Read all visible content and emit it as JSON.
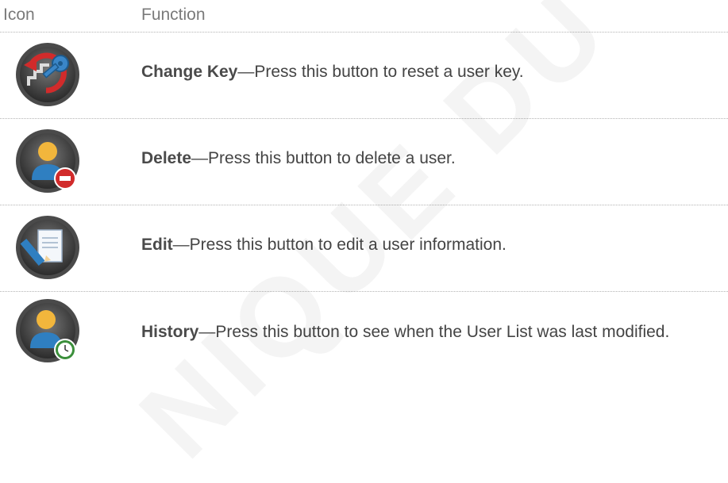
{
  "header": {
    "icon_col": "Icon",
    "function_col": "Function"
  },
  "rows": [
    {
      "icon": "change-key-icon",
      "term": "Change Key",
      "dash": "—",
      "text": "Press this button to reset a user key."
    },
    {
      "icon": "delete-user-icon",
      "term": "Delete",
      "dash": "—",
      "text": "Press this button to delete a user."
    },
    {
      "icon": "edit-user-icon",
      "term": "Edit",
      "dash": "—",
      "text": "Press this button to edit a user information."
    },
    {
      "icon": "history-icon",
      "term": "History",
      "dash": "—",
      "text": "Press this button to see when the User List was last modified."
    }
  ],
  "watermark": "NIQUE DU",
  "colors": {
    "text": "#444444",
    "header": "#7a7a7a",
    "red_accent": "#d12b2b",
    "blue_user": "#2f7fc1",
    "green_clock": "#3b8f3b"
  }
}
